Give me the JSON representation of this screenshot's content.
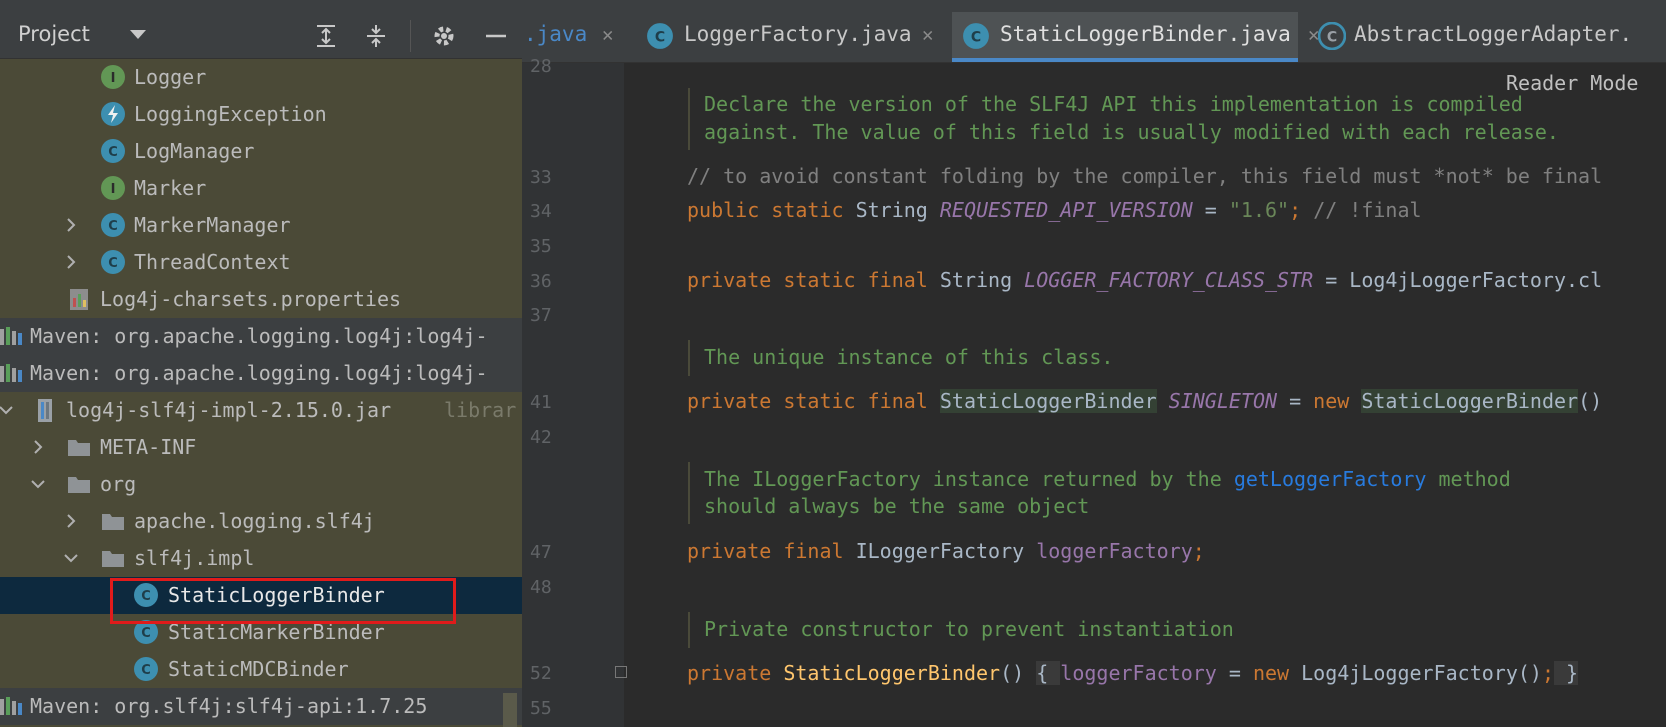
{
  "project_panel": {
    "title": "Project",
    "tree": [
      {
        "label": "Logger",
        "icon": "interface-icon"
      },
      {
        "label": "LoggingException",
        "icon": "exception-class-icon"
      },
      {
        "label": "LogManager",
        "icon": "class-icon"
      },
      {
        "label": "Marker",
        "icon": "interface-icon"
      },
      {
        "label": "MarkerManager",
        "icon": "class-icon"
      },
      {
        "label": "ThreadContext",
        "icon": "class-icon"
      },
      {
        "label": "Log4j-charsets.properties",
        "icon": "properties-file-icon"
      },
      {
        "label": "Maven: org.apache.logging.log4j:log4j-",
        "icon": "library-icon"
      },
      {
        "label": "Maven: org.apache.logging.log4j:log4j-",
        "icon": "library-icon"
      },
      {
        "label": "log4j-slf4j-impl-2.15.0.jar",
        "suffix": "librar",
        "icon": "jar-icon"
      },
      {
        "label": "META-INF",
        "icon": "folder-icon"
      },
      {
        "label": "org",
        "icon": "folder-icon"
      },
      {
        "label": "apache.logging.slf4j",
        "icon": "folder-icon"
      },
      {
        "label": "slf4j.impl",
        "icon": "folder-icon"
      },
      {
        "label": "StaticLoggerBinder",
        "icon": "class-icon"
      },
      {
        "label": "StaticMarkerBinder",
        "icon": "class-icon"
      },
      {
        "label": "StaticMDCBinder",
        "icon": "class-icon"
      },
      {
        "label": "Maven: org.slf4j:slf4j-api:1.7.25",
        "icon": "library-icon"
      }
    ]
  },
  "editor": {
    "tabs": [
      {
        "label": ".java"
      },
      {
        "label": "LoggerFactory.java"
      },
      {
        "label": "StaticLoggerBinder.java",
        "active": true
      },
      {
        "label": "AbstractLoggerAdapter."
      }
    ],
    "reader_mode": "Reader Mode",
    "line_numbers": [
      "28",
      "33",
      "34",
      "35",
      "36",
      "37",
      "41",
      "42",
      "47",
      "48",
      "52",
      "55"
    ],
    "doc_comments": [
      "Declare the version of the SLF4J API this implementation is compiled",
      "against. The value of this field is usually modified with each release.",
      "The unique instance of this class.",
      "The ILoggerFactory instance returned by the ",
      "getLoggerFactory",
      " method",
      "should always be the same object",
      "Private constructor to prevent instantiation"
    ],
    "code": {
      "l33": "// to avoid constant folding by the compiler, this field must *not* be final",
      "l34_kw": "public static ",
      "l34_type": "String ",
      "l34_name": "REQUESTED_API_VERSION",
      "l34_eq": " = ",
      "l34_val": "\"1.6\"",
      "l34_semi": "; ",
      "l34_cm": "// !final",
      "l36_kw": "private static final ",
      "l36_type": "String ",
      "l36_name": "LOGGER_FACTORY_CLASS_STR",
      "l36_rest": " = Log4jLoggerFactory.cl",
      "l41_kw": "private static final ",
      "l41_type": "StaticLoggerBinder",
      "l41_name": "SINGLETON",
      "l41_eq": " = ",
      "l41_new": "new ",
      "l41_ctor": "StaticLoggerBinder",
      "l41_end": "()",
      "l47_kw": "private final ",
      "l47_type": "ILoggerFactory ",
      "l47_name": "loggerFactory",
      "l47_semi": ";",
      "l52_kw": "private ",
      "l52_fn": "StaticLoggerBinder",
      "l52_paren": "() ",
      "l52_ob": "{ ",
      "l52_field": "loggerFactory",
      "l52_eq": " = ",
      "l52_new": "new ",
      "l52_call": "Log4jLoggerFactory()",
      "l52_semi": ";",
      "l52_cb": " }"
    }
  }
}
